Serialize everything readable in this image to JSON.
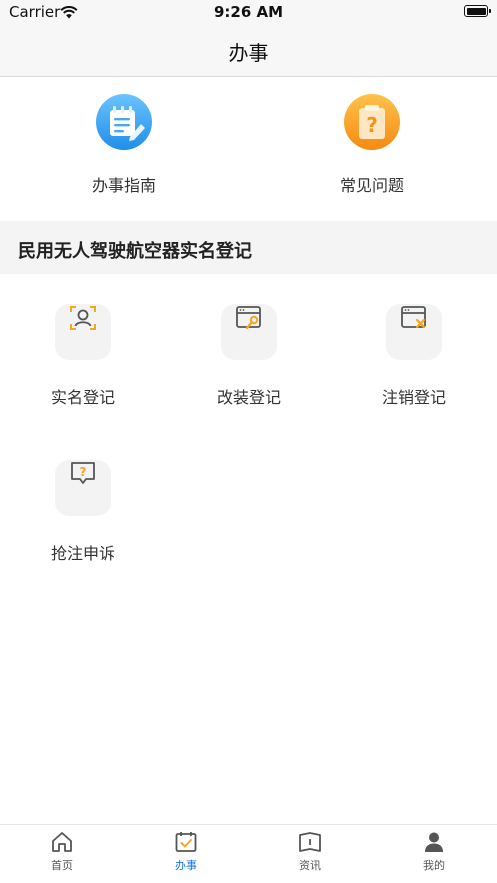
{
  "status_bar": {
    "carrier": "Carrier",
    "time": "9:26 AM"
  },
  "nav": {
    "title": "办事"
  },
  "quick_links": [
    {
      "label": "办事指南",
      "icon": "notepad-icon",
      "color": "#3fa3f0"
    },
    {
      "label": "常见问题",
      "icon": "question-clipboard-icon",
      "color": "#f59a23"
    }
  ],
  "section": {
    "title": "民用无人驾驶航空器实名登记"
  },
  "services": [
    {
      "label": "实名登记",
      "icon": "face-scan-icon"
    },
    {
      "label": "改装登记",
      "icon": "window-wrench-icon"
    },
    {
      "label": "注销登记",
      "icon": "window-close-icon"
    },
    {
      "label": "抢注申诉",
      "icon": "question-message-icon"
    }
  ],
  "tabs": [
    {
      "label": "首页",
      "icon": "home-icon"
    },
    {
      "label": "办事",
      "icon": "calendar-check-icon",
      "active": true
    },
    {
      "label": "资讯",
      "icon": "book-icon"
    },
    {
      "label": "我的",
      "icon": "person-icon"
    }
  ],
  "colors": {
    "accent": "#f5a623",
    "active_tab": "#1a73e8"
  }
}
